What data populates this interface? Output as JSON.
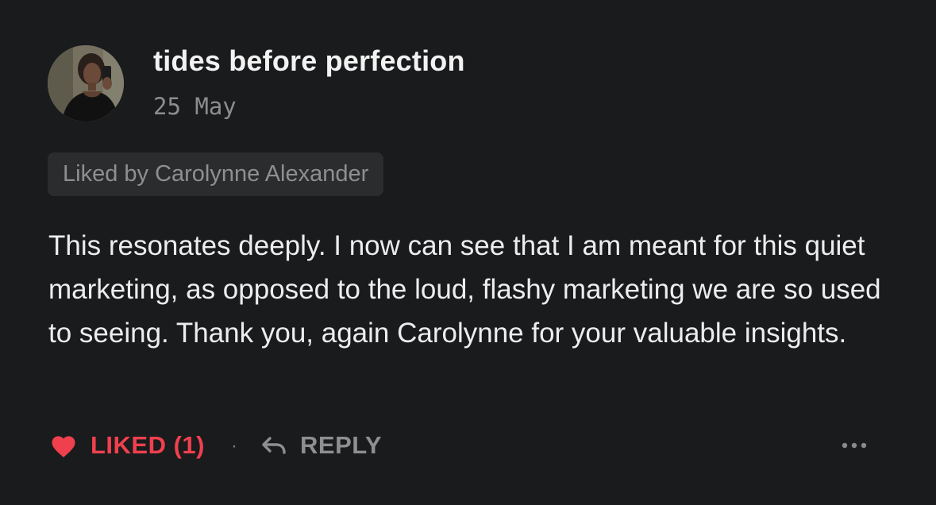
{
  "comment": {
    "author": {
      "name": "tides before perfection",
      "avatar_icon": "avatar-photo"
    },
    "date": "25 May",
    "liked_by": "Liked by Carolynne Alexander",
    "body": "This resonates deeply. I now can see that I am meant for this quiet marketing, as opposed to the loud, flashy marketing we are so used to seeing. Thank you, again Carolynne for your valuable insights.",
    "actions": {
      "like_label": "LIKED (1)",
      "separator": "·",
      "reply_label": "REPLY",
      "more_icon": "more-horizontal-icon"
    }
  },
  "colors": {
    "background": "#1a1b1d",
    "liked_accent": "#f0404e",
    "muted_text": "#8f8f8f",
    "chip_background": "#2b2c2e"
  }
}
